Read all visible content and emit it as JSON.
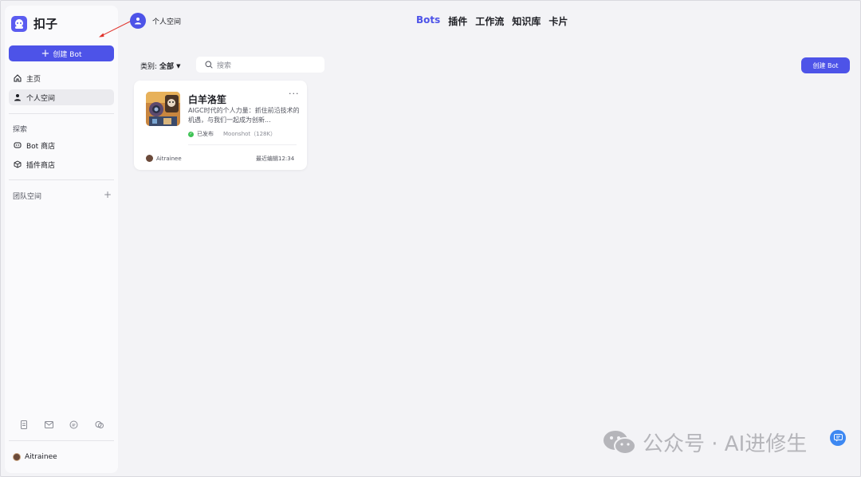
{
  "sidebar": {
    "app_name": "扣子",
    "create_bot_label": "创建 Bot",
    "nav": [
      {
        "label": "主页"
      },
      {
        "label": "个人空间"
      }
    ],
    "explore_label": "探索",
    "explore_items": [
      {
        "label": "Bot 商店"
      },
      {
        "label": "插件商店"
      }
    ],
    "team_label": "团队空间",
    "user_name": "Aitrainee"
  },
  "header": {
    "space_title": "个人空间",
    "tabs": [
      {
        "label": "Bots",
        "active": true
      },
      {
        "label": "插件"
      },
      {
        "label": "工作流"
      },
      {
        "label": "知识库"
      },
      {
        "label": "卡片"
      }
    ]
  },
  "toolbar": {
    "filter_label": "类别:",
    "filter_value": "全部",
    "search_placeholder": "搜索",
    "create_bot_label": "创建 Bot"
  },
  "bots": [
    {
      "name": "白羊洛笙",
      "description": "AIGC时代的个人力量：抓住前沿技术的机遇，与我们一起成为创新...",
      "status": "已发布",
      "model": "Moonshot（128K）",
      "author": "Aitrainee",
      "edited": "最近编辑12:34"
    }
  ],
  "watermark": "公众号 · AI进修生",
  "colors": {
    "accent": "#4d53e8",
    "published": "#3ec254",
    "fab": "#3d88f2"
  }
}
